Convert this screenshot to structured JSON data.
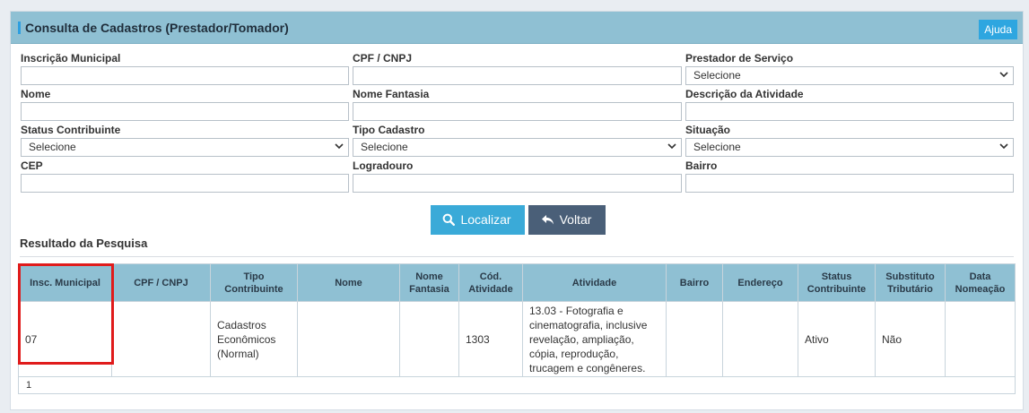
{
  "header": {
    "title": "Consulta de Cadastros (Prestador/Tomador)",
    "help_label": "Ajuda"
  },
  "form": {
    "inscricao_municipal": {
      "label": "Inscrição Municipal",
      "value": ""
    },
    "cpf_cnpj": {
      "label": "CPF / CNPJ",
      "value": ""
    },
    "prestador_servico": {
      "label": "Prestador de Serviço",
      "selected": "Selecione"
    },
    "nome": {
      "label": "Nome",
      "value": ""
    },
    "nome_fantasia": {
      "label": "Nome Fantasia",
      "value": ""
    },
    "descricao_atividade": {
      "label": "Descrição da Atividade",
      "value": ""
    },
    "status_contribuinte": {
      "label": "Status Contribuinte",
      "selected": "Selecione"
    },
    "tipo_cadastro": {
      "label": "Tipo Cadastro",
      "selected": "Selecione"
    },
    "situacao": {
      "label": "Situação",
      "selected": "Selecione"
    },
    "cep": {
      "label": "CEP",
      "value": ""
    },
    "logradouro": {
      "label": "Logradouro",
      "value": ""
    },
    "bairro": {
      "label": "Bairro",
      "value": ""
    }
  },
  "actions": {
    "find_label": "Localizar",
    "back_label": "Voltar"
  },
  "results": {
    "title": "Resultado da Pesquisa",
    "columns": [
      "Insc. Municipal",
      "CPF / CNPJ",
      "Tipo Contribuinte",
      "Nome",
      "Nome Fantasia",
      "Cód. Atividade",
      "Atividade",
      "Bairro",
      "Endereço",
      "Status Contribuinte",
      "Substituto Tributário",
      "Data Nomeação"
    ],
    "rows": [
      {
        "insc_municipal": "07",
        "cpf_cnpj": "",
        "tipo_contribuinte": "Cadastros Econômicos (Normal)",
        "nome": "",
        "nome_fantasia": "",
        "cod_atividade": "1303",
        "atividade": "13.03 - Fotografia e cinematografia, inclusive revelação, ampliação, cópia, reprodução, trucagem e congêneres.",
        "bairro": "",
        "endereco": "",
        "status_contribuinte": "Ativo",
        "substituto_tributario": "Não",
        "data_nomeacao": ""
      }
    ],
    "page": "1"
  },
  "colors": {
    "header": "#8fc0d3",
    "accent": "#3aaad8",
    "back": "#4a5f78",
    "highlight": "#e01b1b"
  }
}
